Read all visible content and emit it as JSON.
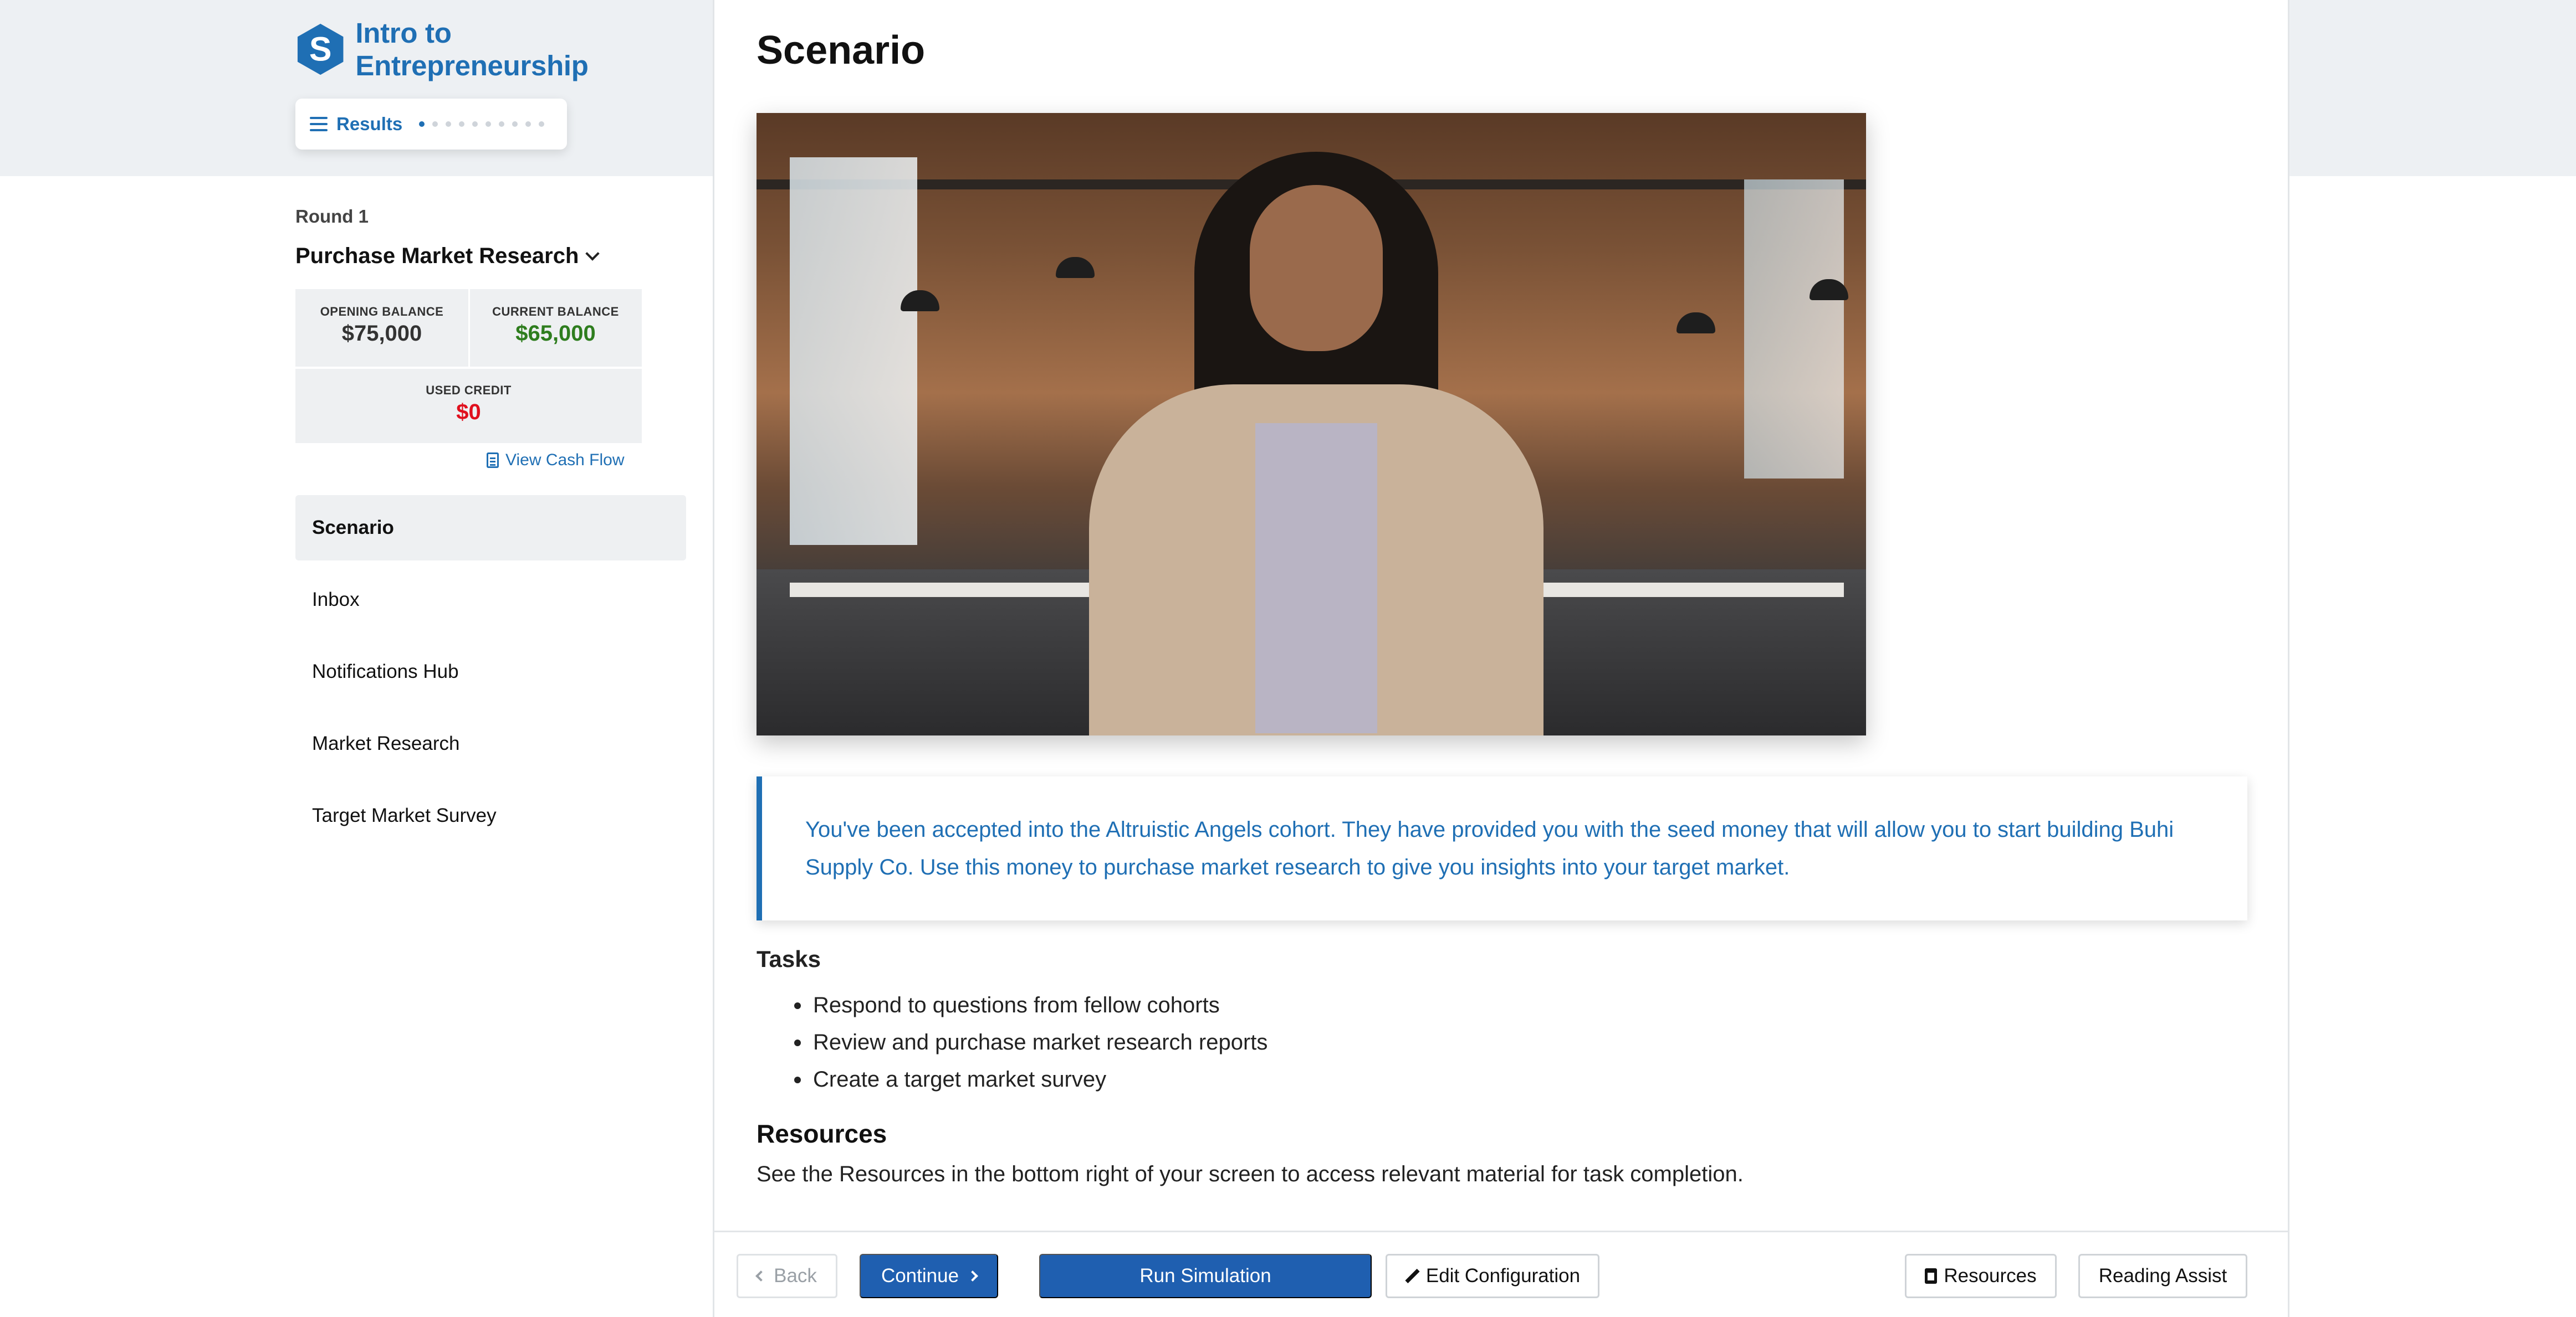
{
  "app": {
    "title": "Intro to Entrepreneurship",
    "results_label": "Results",
    "brand_color": "#1f6fb4"
  },
  "progress": {
    "total_dots": 10,
    "active_index": 0
  },
  "round": {
    "label": "Round 1",
    "decision": "Purchase Market Research"
  },
  "balances": {
    "opening_label": "OPENING BALANCE",
    "opening_value": "$75,000",
    "current_label": "CURRENT BALANCE",
    "current_value": "$65,000",
    "credit_label": "USED CREDIT",
    "credit_value": "$0"
  },
  "cash_flow_link": "View Cash Flow",
  "nav": {
    "items": [
      {
        "label": "Scenario",
        "active": true
      },
      {
        "label": "Inbox",
        "active": false
      },
      {
        "label": "Notifications Hub",
        "active": false
      },
      {
        "label": "Market Research",
        "active": false
      },
      {
        "label": "Target Market Survey",
        "active": false
      }
    ]
  },
  "main": {
    "title": "Scenario",
    "callout": "You've been accepted into the Altruistic Angels cohort. They have provided you with the seed money that will allow you to start building Buhi Supply Co. Use this money to purchase market research to give you insights into your target market.",
    "tasks_title": "Tasks",
    "tasks": [
      "Respond to questions from fellow cohorts",
      "Review and purchase market research reports",
      "Create a target market survey"
    ],
    "resources_title": "Resources",
    "resources_text": "See the Resources in the bottom right of your screen to access relevant material for task completion."
  },
  "footer": {
    "back": "Back",
    "continue": "Continue",
    "run_simulation": "Run Simulation",
    "edit_configuration": "Edit Configuration",
    "resources": "Resources",
    "reading_assist": "Reading Assist"
  }
}
